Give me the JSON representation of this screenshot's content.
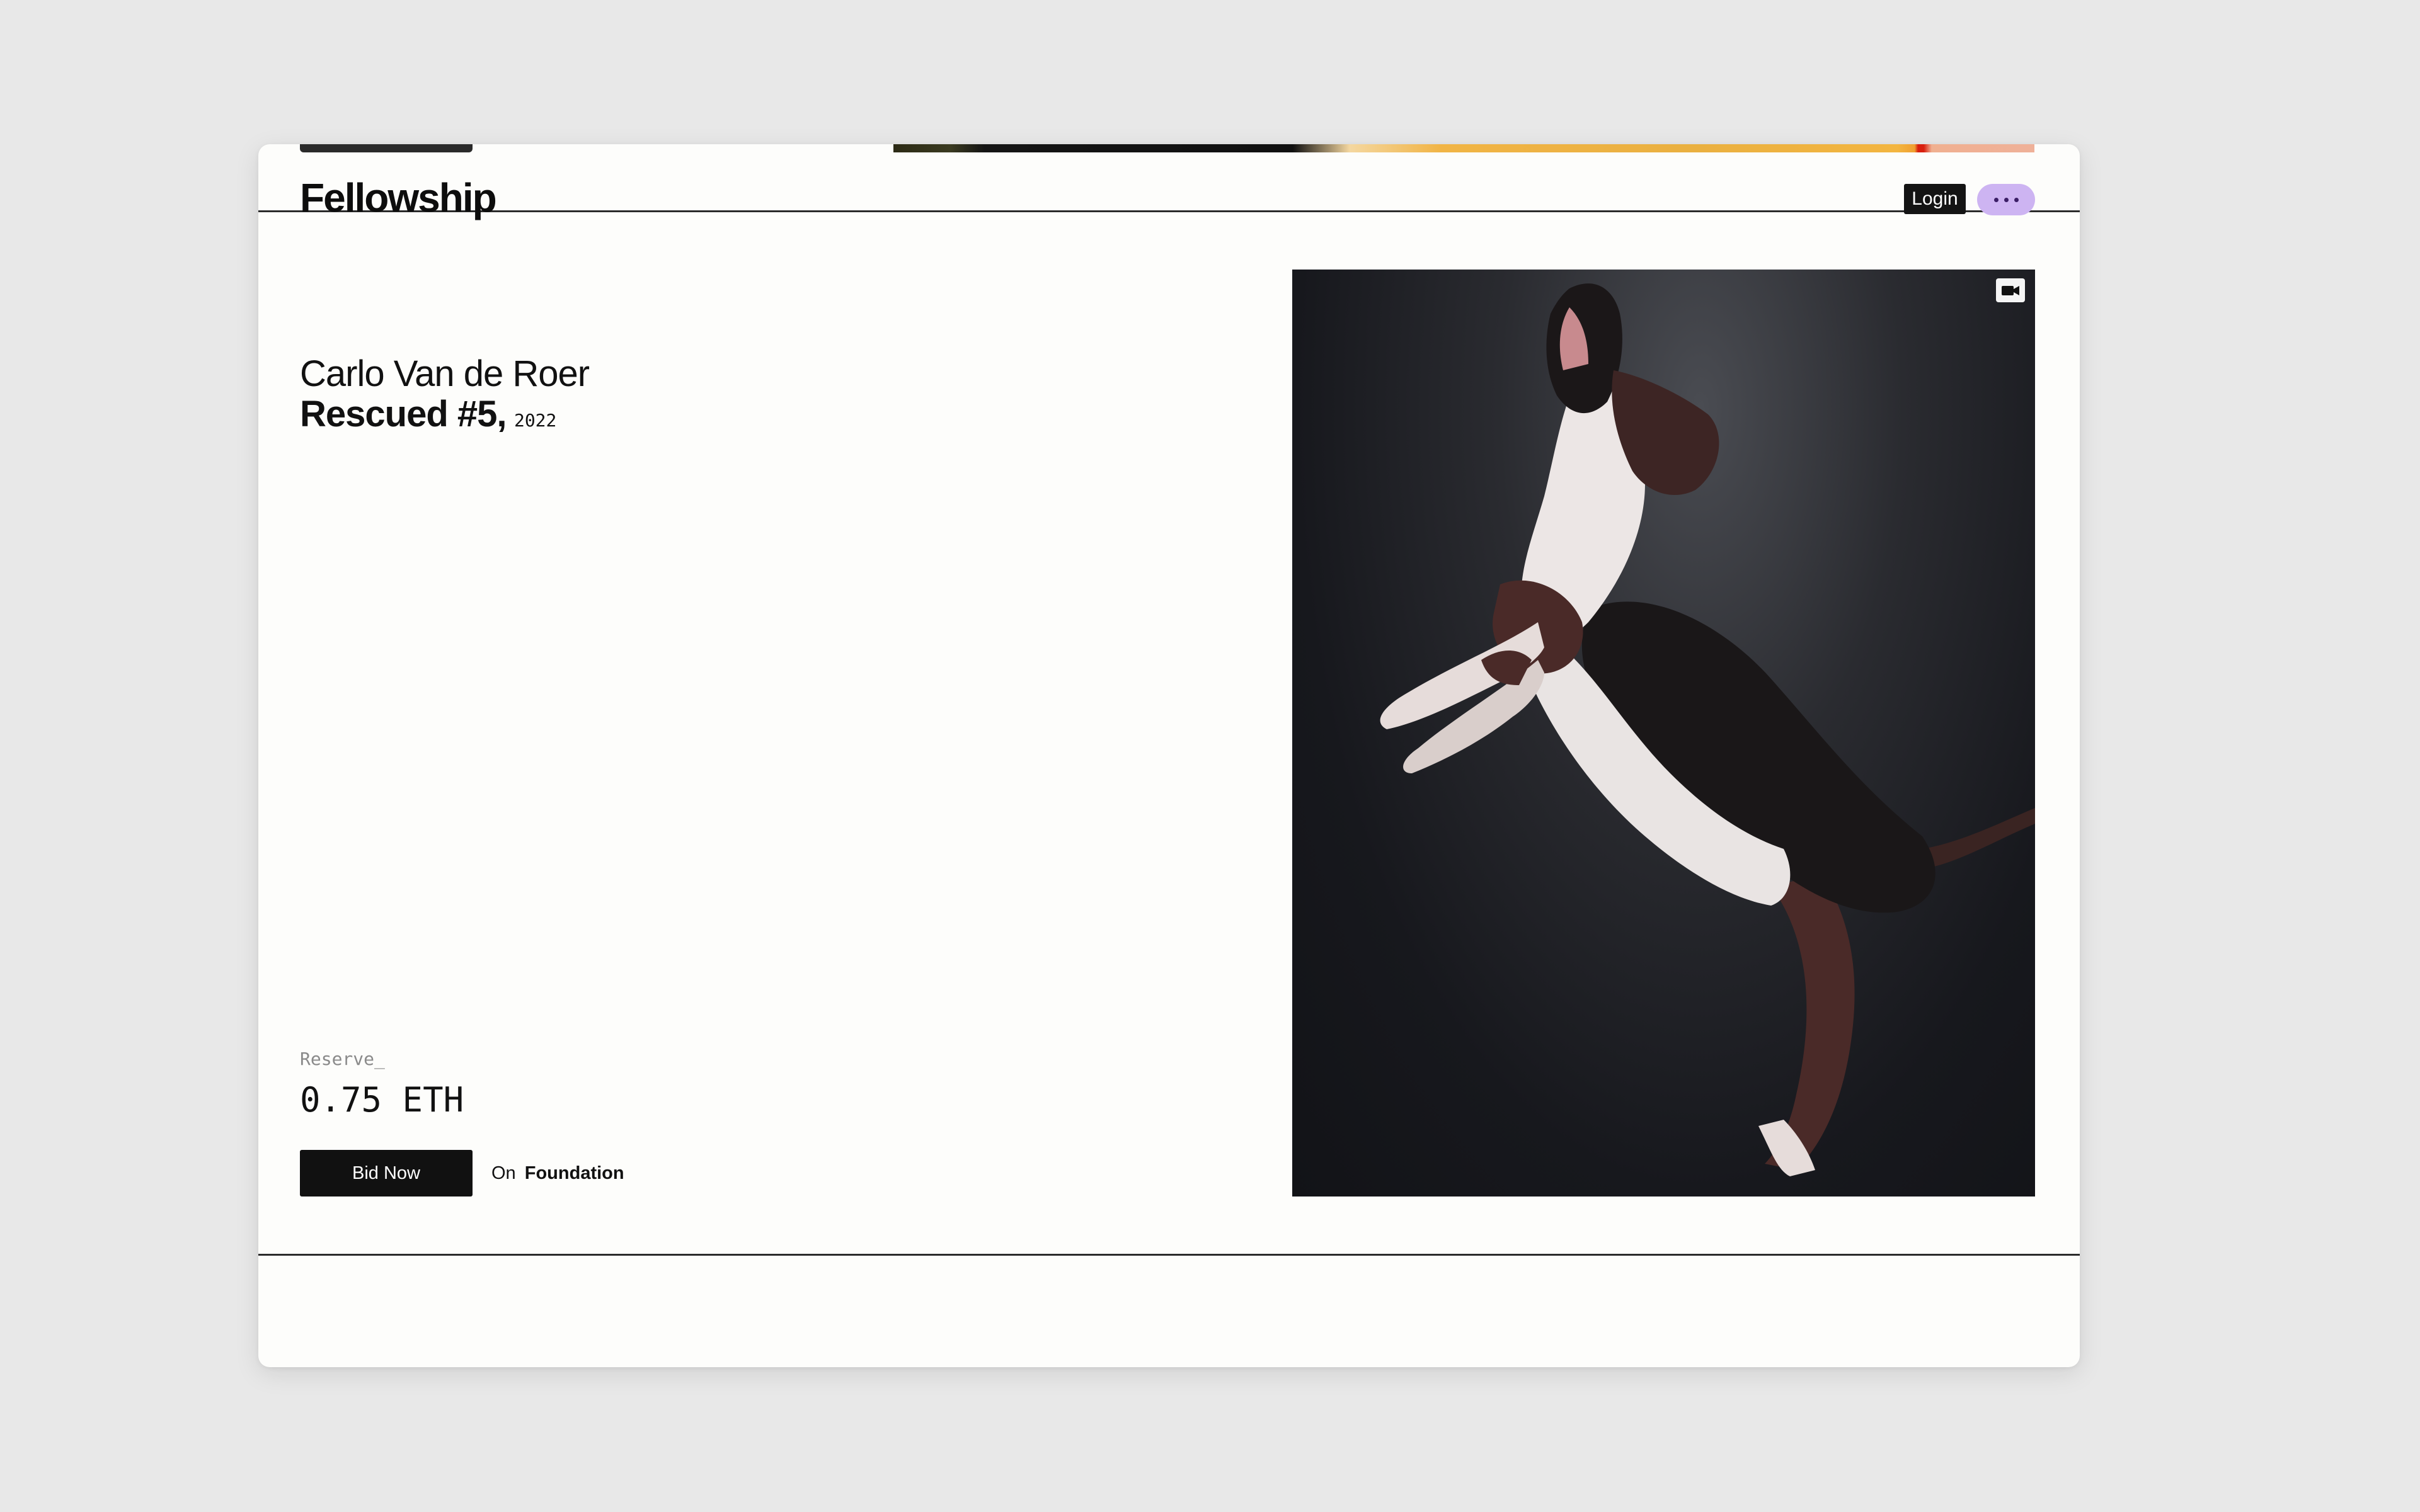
{
  "header": {
    "logo": "Fellowship",
    "login_label": "Login",
    "more_label": "more options"
  },
  "artwork": {
    "artist": "Carlo Van de Roer",
    "title": "Rescued #5,",
    "year": "2022",
    "media_type_icon": "video-camera-icon"
  },
  "sale": {
    "reserve_label": "Reserve_",
    "reserve_value": "0.75 ETH",
    "bid_label": "Bid Now",
    "on_prefix": "On",
    "platform": "Foundation"
  },
  "colors": {
    "accent_pill": "#cdb4f2",
    "button_dark": "#111111",
    "page_background": "#fdfdfb"
  }
}
